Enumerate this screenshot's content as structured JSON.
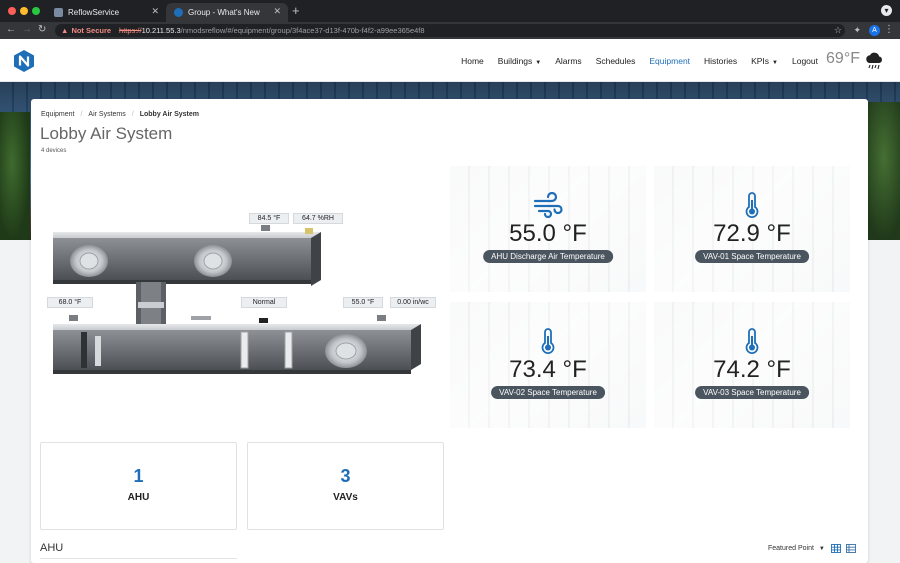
{
  "browser": {
    "tabs": [
      {
        "title": "ReflowService"
      },
      {
        "title": "Group - What's New"
      }
    ],
    "url": {
      "security": "Not Secure",
      "scheme": "https://",
      "host": "10.211.55.3",
      "path": "/nmodsreflow/#/equipment/group/3f4ace37-d13f-470b-f4f2-a99ee365e4f8"
    },
    "profile_initial": "A"
  },
  "nav": {
    "items": [
      {
        "label": "Home"
      },
      {
        "label": "Buildings"
      },
      {
        "label": "Alarms"
      },
      {
        "label": "Schedules"
      },
      {
        "label": "Equipment"
      },
      {
        "label": "Histories"
      },
      {
        "label": "KPIs"
      },
      {
        "label": "Logout"
      }
    ],
    "weather_temp": "69°F",
    "colors": {
      "active": "#1f6fb8",
      "logo": "#1f6fb8"
    }
  },
  "page": {
    "breadcrumb": [
      "Equipment",
      "Air Systems",
      "Lobby Air System"
    ],
    "title": "Lobby Air System",
    "subtitle": "4 devices"
  },
  "diagram": {
    "readings": {
      "return_temp": "84.5 °F",
      "return_humidity": "64.7 %RH",
      "outside_temp": "68.0 °F",
      "filter_status": "Normal",
      "discharge_temp": "55.0 °F",
      "static_pressure": "0.00 in/wc"
    }
  },
  "tiles": [
    {
      "value": "55.0 °F",
      "label": "AHU Discharge Air Temperature",
      "icon": "wind-icon"
    },
    {
      "value": "72.9 °F",
      "label": "VAV-01 Space Temperature",
      "icon": "thermometer-icon"
    },
    {
      "value": "73.4 °F",
      "label": "VAV-02 Space Temperature",
      "icon": "thermometer-icon"
    },
    {
      "value": "74.2 °F",
      "label": "VAV-03 Space Temperature",
      "icon": "thermometer-icon"
    }
  ],
  "counts": [
    {
      "number": "1",
      "label": "AHU"
    },
    {
      "number": "3",
      "label": "VAVs"
    }
  ],
  "section": {
    "title": "AHU",
    "sort_label": "Featured Point"
  }
}
